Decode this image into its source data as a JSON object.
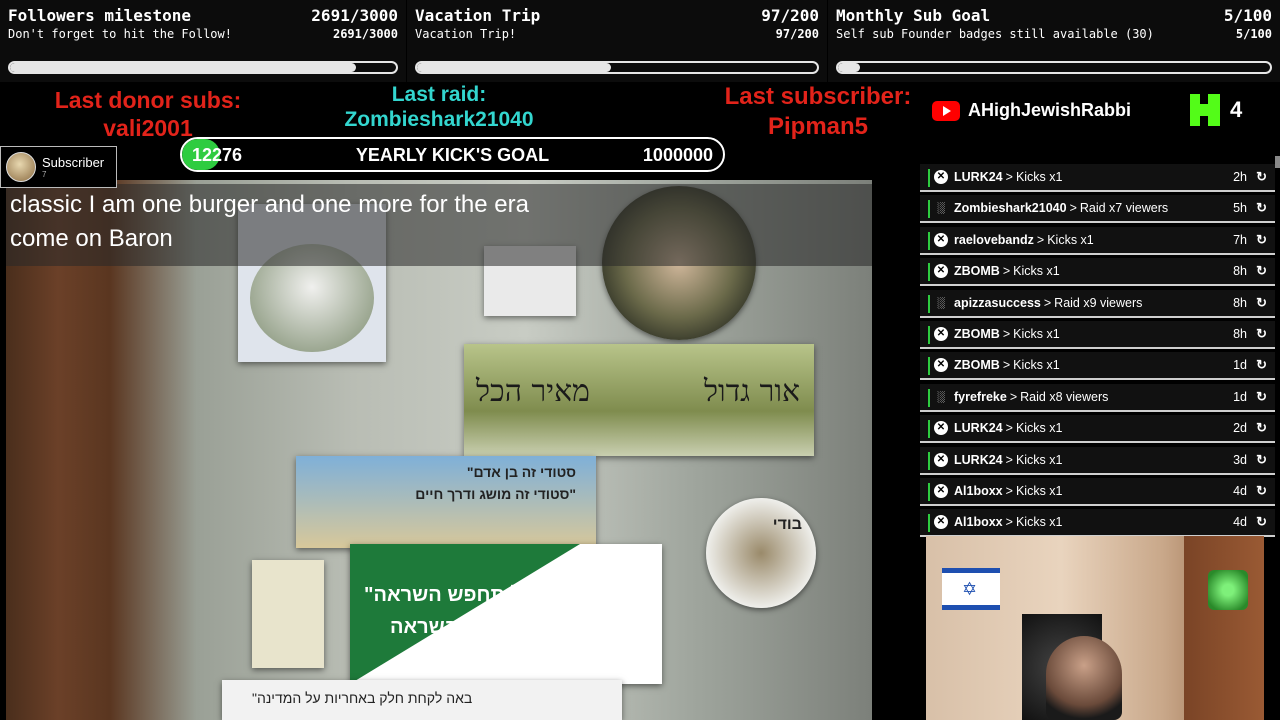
{
  "goals": [
    {
      "title": "Followers milestone",
      "subtitle": "Don't forget to hit the Follow!",
      "count": "2691/3000",
      "progress": 0.897
    },
    {
      "title": "Vacation Trip",
      "subtitle": "Vacation Trip!",
      "count": "97/200",
      "progress": 0.485
    },
    {
      "title": "Monthly Sub Goal",
      "subtitle": "Self sub Founder badges still available (30)",
      "count": "5/100",
      "progress": 0.05
    }
  ],
  "info": {
    "donor_label": "Last donor subs:",
    "donor_name": "vali2001",
    "raid_label": "Last raid:",
    "raid_name": "Zombieshark21040",
    "sub_label": "Last subscriber:",
    "sub_name": "Pipman5"
  },
  "youtube": {
    "channel": "AHighJewishRabbi"
  },
  "kick": {
    "count": "4"
  },
  "yearly_goal": {
    "current": "12276",
    "title": "YEARLY KICK'S GOAL",
    "target": "1000000",
    "progress": 0.012276
  },
  "subscriber_badge": {
    "label": "Subscriber",
    "small": "7"
  },
  "caption": {
    "line1": "classic I am one burger and one more for the era",
    "line2": "come on Baron"
  },
  "feed": [
    {
      "user": "LURK24",
      "action": "Kicks x1",
      "time": "2h",
      "type": "kick"
    },
    {
      "user": "Zombieshark21040",
      "action": "Raid x7 viewers",
      "time": "5h",
      "type": "raid"
    },
    {
      "user": "raelovebandz",
      "action": "Kicks x1",
      "time": "7h",
      "type": "kick"
    },
    {
      "user": "ZBOMB",
      "action": "Kicks x1",
      "time": "8h",
      "type": "kick"
    },
    {
      "user": "apizzasuccess",
      "action": "Raid x9 viewers",
      "time": "8h",
      "type": "raid"
    },
    {
      "user": "ZBOMB",
      "action": "Kicks x1",
      "time": "8h",
      "type": "kick"
    },
    {
      "user": "ZBOMB",
      "action": "Kicks x1",
      "time": "1d",
      "type": "kick"
    },
    {
      "user": "fyrefreke",
      "action": "Raid x8 viewers",
      "time": "1d",
      "type": "raid"
    },
    {
      "user": "LURK24",
      "action": "Kicks x1",
      "time": "2d",
      "type": "kick"
    },
    {
      "user": "LURK24",
      "action": "Kicks x1",
      "time": "3d",
      "type": "kick"
    },
    {
      "user": "Al1boxx",
      "action": "Kicks x1",
      "time": "4d",
      "type": "kick"
    },
    {
      "user": "Al1boxx",
      "action": "Kicks x1",
      "time": "4d",
      "type": "kick"
    }
  ],
  "posters": {
    "p4_left": "מאיר הכל",
    "p4_right": "אור גדול",
    "p5_line1": "\"סטודי זה בן אדם",
    "p5_line2": "סטודי זה מושג ודרך חיים\"",
    "p6_line1": "\"אל תחפש השראה,",
    "p6_line2": "הייה השראה\"",
    "p8_title": "בודי",
    "p9_text": "\"באה לקחת חלק באחריות על המדינה"
  },
  "colors": {
    "accent_red": "#e2231a",
    "accent_teal": "#33d6cf",
    "kick_green": "#53fc18",
    "goal_green": "#2ecc40"
  },
  "icons": {
    "kick": "kick-x-icon",
    "raid": "raid-people-icon",
    "replay": "replay-icon",
    "youtube": "youtube-icon"
  }
}
